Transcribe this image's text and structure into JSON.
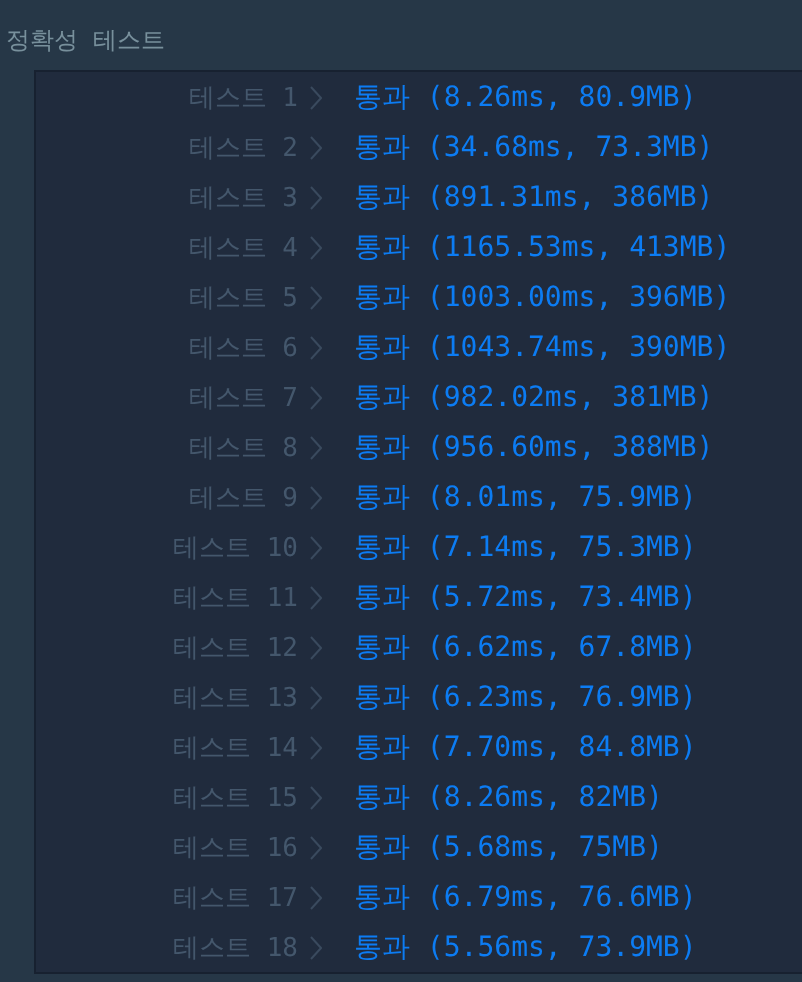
{
  "header": {
    "title": "정확성  테스트"
  },
  "results": [
    {
      "label": "테스트 1",
      "result": "통과 (8.26ms, 80.9MB)"
    },
    {
      "label": "테스트 2",
      "result": "통과 (34.68ms, 73.3MB)"
    },
    {
      "label": "테스트 3",
      "result": "통과 (891.31ms, 386MB)"
    },
    {
      "label": "테스트 4",
      "result": "통과 (1165.53ms, 413MB)"
    },
    {
      "label": "테스트 5",
      "result": "통과 (1003.00ms, 396MB)"
    },
    {
      "label": "테스트 6",
      "result": "통과 (1043.74ms, 390MB)"
    },
    {
      "label": "테스트 7",
      "result": "통과 (982.02ms, 381MB)"
    },
    {
      "label": "테스트 8",
      "result": "통과 (956.60ms, 388MB)"
    },
    {
      "label": "테스트 9",
      "result": "통과 (8.01ms, 75.9MB)"
    },
    {
      "label": "테스트 10",
      "result": "통과 (7.14ms, 75.3MB)"
    },
    {
      "label": "테스트 11",
      "result": "통과 (5.72ms, 73.4MB)"
    },
    {
      "label": "테스트 12",
      "result": "통과 (6.62ms, 67.8MB)"
    },
    {
      "label": "테스트 13",
      "result": "통과 (6.23ms, 76.9MB)"
    },
    {
      "label": "테스트 14",
      "result": "통과 (7.70ms, 84.8MB)"
    },
    {
      "label": "테스트 15",
      "result": "통과 (8.26ms, 82MB)"
    },
    {
      "label": "테스트 16",
      "result": "통과 (5.68ms, 75MB)"
    },
    {
      "label": "테스트 17",
      "result": "통과 (6.79ms, 76.6MB)"
    },
    {
      "label": "테스트 18",
      "result": "통과 (5.56ms, 73.9MB)"
    }
  ]
}
